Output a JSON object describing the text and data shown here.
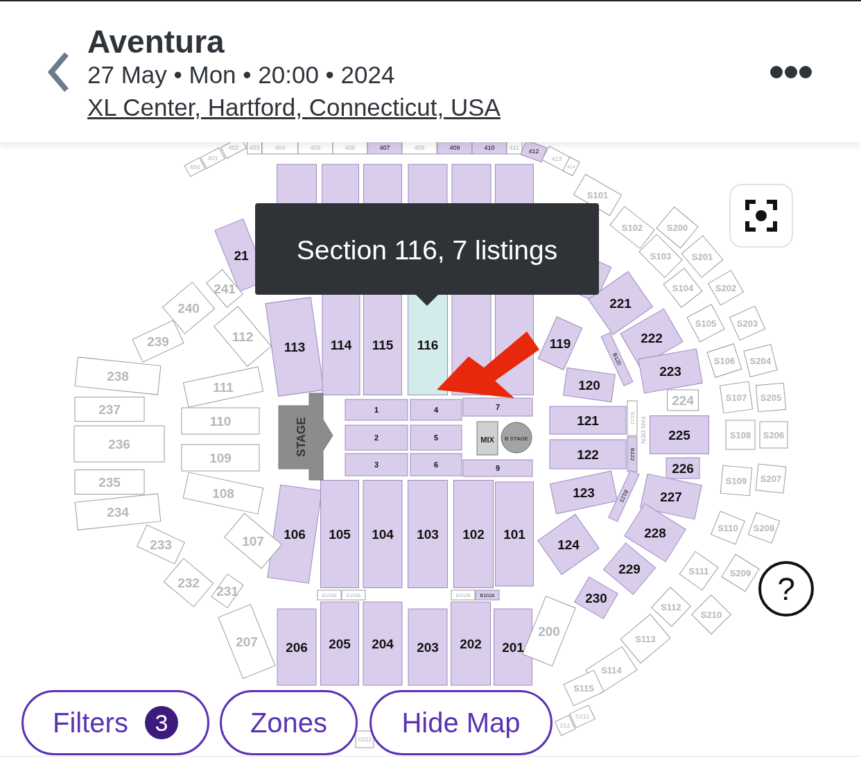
{
  "header": {
    "title": "Aventura",
    "date_line": "27 May • Mon • 20:00 • 2024",
    "venue": "XL Center, Hartford, Connecticut, USA"
  },
  "map": {
    "sections": [
      {
        "label": "400",
        "available": false,
        "selected": false
      },
      {
        "label": "401",
        "available": false,
        "selected": false
      },
      {
        "label": "402",
        "available": false,
        "selected": false
      },
      {
        "label": "403",
        "available": false,
        "selected": false
      },
      {
        "label": "404",
        "available": false,
        "selected": false
      },
      {
        "label": "405",
        "available": false,
        "selected": false
      },
      {
        "label": "406",
        "available": false,
        "selected": false
      },
      {
        "label": "407",
        "available": true,
        "selected": false
      },
      {
        "label": "408",
        "available": false,
        "selected": false
      },
      {
        "label": "409",
        "available": true,
        "selected": false
      },
      {
        "label": "410",
        "available": true,
        "selected": false
      },
      {
        "label": "411",
        "available": false,
        "selected": false
      },
      {
        "label": "412",
        "available": true,
        "selected": false
      },
      {
        "label": "413",
        "available": false,
        "selected": false
      },
      {
        "label": "414",
        "available": false,
        "selected": false
      },
      {
        "available": true,
        "selected": false
      },
      {
        "available": true,
        "selected": false
      },
      {
        "available": true,
        "selected": false
      },
      {
        "available": true,
        "selected": false
      },
      {
        "available": true,
        "selected": false
      },
      {
        "available": true,
        "selected": false
      },
      {
        "label": "21",
        "available": true,
        "selected": false
      },
      {
        "available": true,
        "selected": false
      },
      {
        "label": "113",
        "available": true,
        "selected": false
      },
      {
        "label": "114",
        "available": true,
        "selected": false
      },
      {
        "label": "115",
        "available": true,
        "selected": false
      },
      {
        "label": "116",
        "available": true,
        "selected": true
      },
      {
        "available": true,
        "selected": false
      },
      {
        "available": true,
        "selected": false
      },
      {
        "label": "119",
        "available": true,
        "selected": false
      },
      {
        "label": "120",
        "available": true,
        "selected": false
      },
      {
        "label": "121",
        "available": true,
        "selected": false
      },
      {
        "label": "122",
        "available": true,
        "selected": false
      },
      {
        "label": "123",
        "available": true,
        "selected": false
      },
      {
        "label": "124",
        "available": true,
        "selected": false
      },
      {
        "label": "B120",
        "available": true,
        "selected": false
      },
      {
        "label": "B121",
        "available": false,
        "selected": false
      },
      {
        "label": "B122",
        "available": true,
        "selected": false
      },
      {
        "label": "B123",
        "available": true,
        "selected": false
      },
      {
        "label": "1",
        "available": true,
        "selected": false
      },
      {
        "label": "4",
        "available": true,
        "selected": false
      },
      {
        "label": "7",
        "available": true,
        "selected": false
      },
      {
        "label": "2",
        "available": true,
        "selected": false
      },
      {
        "label": "5",
        "available": true,
        "selected": false
      },
      {
        "label": "3",
        "available": true,
        "selected": false
      },
      {
        "label": "6",
        "available": true,
        "selected": false
      },
      {
        "label": "9",
        "available": true,
        "selected": false
      },
      {
        "label": "106",
        "available": true,
        "selected": false
      },
      {
        "label": "105",
        "available": true,
        "selected": false
      },
      {
        "label": "104",
        "available": true,
        "selected": false
      },
      {
        "label": "103",
        "available": true,
        "selected": false
      },
      {
        "label": "102",
        "available": true,
        "selected": false
      },
      {
        "label": "101",
        "available": true,
        "selected": false
      },
      {
        "label": "B105B",
        "available": false,
        "selected": false
      },
      {
        "label": "B105A",
        "available": false,
        "selected": false
      },
      {
        "label": "B102B",
        "available": false,
        "selected": false
      },
      {
        "label": "B102A",
        "available": true,
        "selected": false
      },
      {
        "label": "206",
        "available": true,
        "selected": false
      },
      {
        "label": "205",
        "available": true,
        "selected": false
      },
      {
        "label": "204",
        "available": true,
        "selected": false
      },
      {
        "label": "203",
        "available": true,
        "selected": false
      },
      {
        "label": "202",
        "available": true,
        "selected": false
      },
      {
        "label": "201",
        "available": true,
        "selected": false
      },
      {
        "label": "221",
        "available": true,
        "selected": false
      },
      {
        "label": "222",
        "available": true,
        "selected": false
      },
      {
        "label": "223",
        "available": true,
        "selected": false
      },
      {
        "label": "224",
        "available": false,
        "selected": false
      },
      {
        "label": "225",
        "available": true,
        "selected": false
      },
      {
        "label": "226",
        "available": true,
        "selected": false
      },
      {
        "label": "227",
        "available": true,
        "selected": false
      },
      {
        "label": "228",
        "available": true,
        "selected": false
      },
      {
        "label": "229",
        "available": true,
        "selected": false
      },
      {
        "label": "230",
        "available": true,
        "selected": false
      },
      {
        "label": "241",
        "available": false,
        "selected": false
      },
      {
        "label": "240",
        "available": false,
        "selected": false
      },
      {
        "label": "239",
        "available": false,
        "selected": false
      },
      {
        "label": "238",
        "available": false,
        "selected": false
      },
      {
        "label": "237",
        "available": false,
        "selected": false
      },
      {
        "label": "236",
        "available": false,
        "selected": false
      },
      {
        "label": "235",
        "available": false,
        "selected": false
      },
      {
        "label": "234",
        "available": false,
        "selected": false
      },
      {
        "label": "233",
        "available": false,
        "selected": false
      },
      {
        "label": "232",
        "available": false,
        "selected": false
      },
      {
        "label": "231",
        "available": false,
        "selected": false
      },
      {
        "label": "112",
        "available": false,
        "selected": false
      },
      {
        "label": "111",
        "available": false,
        "selected": false
      },
      {
        "label": "110",
        "available": false,
        "selected": false
      },
      {
        "label": "109",
        "available": false,
        "selected": false
      },
      {
        "label": "108",
        "available": false,
        "selected": false
      },
      {
        "label": "107",
        "available": false,
        "selected": false
      },
      {
        "label": "207",
        "available": false,
        "selected": false
      },
      {
        "label": "200",
        "available": false,
        "selected": false
      },
      {
        "label": "S101",
        "available": false,
        "selected": false
      },
      {
        "label": "S102",
        "available": false,
        "selected": false
      },
      {
        "label": "S103",
        "available": false,
        "selected": false
      },
      {
        "label": "S104",
        "available": false,
        "selected": false
      },
      {
        "label": "S105",
        "available": false,
        "selected": false
      },
      {
        "label": "S106",
        "available": false,
        "selected": false
      },
      {
        "label": "S107",
        "available": false,
        "selected": false
      },
      {
        "label": "S108",
        "available": false,
        "selected": false
      },
      {
        "label": "S109",
        "available": false,
        "selected": false
      },
      {
        "label": "S110",
        "available": false,
        "selected": false
      },
      {
        "label": "S111",
        "available": false,
        "selected": false
      },
      {
        "label": "S112",
        "available": false,
        "selected": false
      },
      {
        "label": "S113",
        "available": false,
        "selected": false
      },
      {
        "label": "S114",
        "available": false,
        "selected": false
      },
      {
        "label": "S115",
        "available": false,
        "selected": false
      },
      {
        "label": "S211",
        "available": false,
        "selected": false
      },
      {
        "label": "212",
        "available": false,
        "selected": false
      },
      {
        "label": "S200",
        "available": false,
        "selected": false
      },
      {
        "label": "S201",
        "available": false,
        "selected": false
      },
      {
        "label": "S202",
        "available": false,
        "selected": false
      },
      {
        "label": "S203",
        "available": false,
        "selected": false
      },
      {
        "label": "S204",
        "available": false,
        "selected": false
      },
      {
        "label": "S205",
        "available": false,
        "selected": false
      },
      {
        "label": "S206",
        "available": false,
        "selected": false
      },
      {
        "label": "S207",
        "available": false,
        "selected": false
      },
      {
        "label": "S208",
        "available": false,
        "selected": false
      },
      {
        "label": "S209",
        "available": false,
        "selected": false
      },
      {
        "label": "S210",
        "available": false,
        "selected": false
      },
      {
        "label": "S222",
        "available": false,
        "selected": false
      }
    ],
    "stage_label": "STAGE",
    "mix_label": "MIX",
    "b_stage_label": "B STAGE",
    "fan_den_label": "FAN DEN",
    "tooltip": "Section 116, 7 listings",
    "help": "?"
  },
  "buttons": [
    {
      "kind": "filters",
      "label": "Filters",
      "badge": "3"
    },
    {
      "kind": "plain",
      "label": "Zones"
    },
    {
      "kind": "plain",
      "label": "Hide Map"
    }
  ]
}
